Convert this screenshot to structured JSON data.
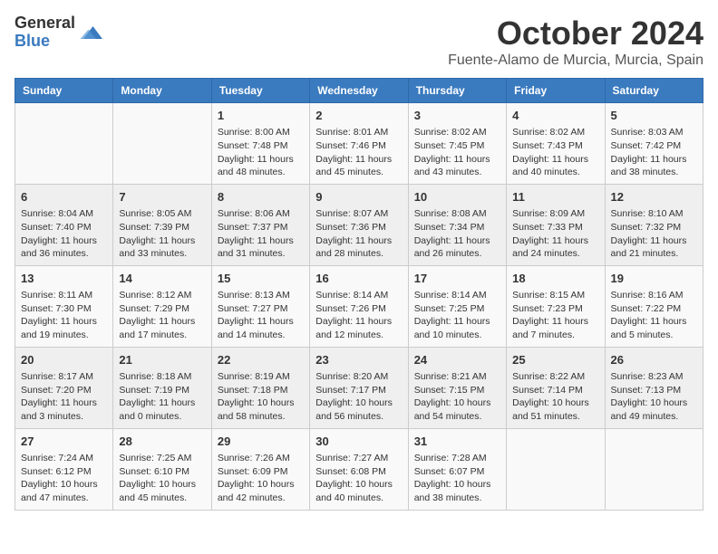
{
  "header": {
    "logo_general": "General",
    "logo_blue": "Blue",
    "month": "October 2024",
    "location": "Fuente-Alamo de Murcia, Murcia, Spain"
  },
  "weekdays": [
    "Sunday",
    "Monday",
    "Tuesday",
    "Wednesday",
    "Thursday",
    "Friday",
    "Saturday"
  ],
  "weeks": [
    [
      {
        "day": "",
        "info": ""
      },
      {
        "day": "",
        "info": ""
      },
      {
        "day": "1",
        "info": "Sunrise: 8:00 AM\nSunset: 7:48 PM\nDaylight: 11 hours and 48 minutes."
      },
      {
        "day": "2",
        "info": "Sunrise: 8:01 AM\nSunset: 7:46 PM\nDaylight: 11 hours and 45 minutes."
      },
      {
        "day": "3",
        "info": "Sunrise: 8:02 AM\nSunset: 7:45 PM\nDaylight: 11 hours and 43 minutes."
      },
      {
        "day": "4",
        "info": "Sunrise: 8:02 AM\nSunset: 7:43 PM\nDaylight: 11 hours and 40 minutes."
      },
      {
        "day": "5",
        "info": "Sunrise: 8:03 AM\nSunset: 7:42 PM\nDaylight: 11 hours and 38 minutes."
      }
    ],
    [
      {
        "day": "6",
        "info": "Sunrise: 8:04 AM\nSunset: 7:40 PM\nDaylight: 11 hours and 36 minutes."
      },
      {
        "day": "7",
        "info": "Sunrise: 8:05 AM\nSunset: 7:39 PM\nDaylight: 11 hours and 33 minutes."
      },
      {
        "day": "8",
        "info": "Sunrise: 8:06 AM\nSunset: 7:37 PM\nDaylight: 11 hours and 31 minutes."
      },
      {
        "day": "9",
        "info": "Sunrise: 8:07 AM\nSunset: 7:36 PM\nDaylight: 11 hours and 28 minutes."
      },
      {
        "day": "10",
        "info": "Sunrise: 8:08 AM\nSunset: 7:34 PM\nDaylight: 11 hours and 26 minutes."
      },
      {
        "day": "11",
        "info": "Sunrise: 8:09 AM\nSunset: 7:33 PM\nDaylight: 11 hours and 24 minutes."
      },
      {
        "day": "12",
        "info": "Sunrise: 8:10 AM\nSunset: 7:32 PM\nDaylight: 11 hours and 21 minutes."
      }
    ],
    [
      {
        "day": "13",
        "info": "Sunrise: 8:11 AM\nSunset: 7:30 PM\nDaylight: 11 hours and 19 minutes."
      },
      {
        "day": "14",
        "info": "Sunrise: 8:12 AM\nSunset: 7:29 PM\nDaylight: 11 hours and 17 minutes."
      },
      {
        "day": "15",
        "info": "Sunrise: 8:13 AM\nSunset: 7:27 PM\nDaylight: 11 hours and 14 minutes."
      },
      {
        "day": "16",
        "info": "Sunrise: 8:14 AM\nSunset: 7:26 PM\nDaylight: 11 hours and 12 minutes."
      },
      {
        "day": "17",
        "info": "Sunrise: 8:14 AM\nSunset: 7:25 PM\nDaylight: 11 hours and 10 minutes."
      },
      {
        "day": "18",
        "info": "Sunrise: 8:15 AM\nSunset: 7:23 PM\nDaylight: 11 hours and 7 minutes."
      },
      {
        "day": "19",
        "info": "Sunrise: 8:16 AM\nSunset: 7:22 PM\nDaylight: 11 hours and 5 minutes."
      }
    ],
    [
      {
        "day": "20",
        "info": "Sunrise: 8:17 AM\nSunset: 7:20 PM\nDaylight: 11 hours and 3 minutes."
      },
      {
        "day": "21",
        "info": "Sunrise: 8:18 AM\nSunset: 7:19 PM\nDaylight: 11 hours and 0 minutes."
      },
      {
        "day": "22",
        "info": "Sunrise: 8:19 AM\nSunset: 7:18 PM\nDaylight: 10 hours and 58 minutes."
      },
      {
        "day": "23",
        "info": "Sunrise: 8:20 AM\nSunset: 7:17 PM\nDaylight: 10 hours and 56 minutes."
      },
      {
        "day": "24",
        "info": "Sunrise: 8:21 AM\nSunset: 7:15 PM\nDaylight: 10 hours and 54 minutes."
      },
      {
        "day": "25",
        "info": "Sunrise: 8:22 AM\nSunset: 7:14 PM\nDaylight: 10 hours and 51 minutes."
      },
      {
        "day": "26",
        "info": "Sunrise: 8:23 AM\nSunset: 7:13 PM\nDaylight: 10 hours and 49 minutes."
      }
    ],
    [
      {
        "day": "27",
        "info": "Sunrise: 7:24 AM\nSunset: 6:12 PM\nDaylight: 10 hours and 47 minutes."
      },
      {
        "day": "28",
        "info": "Sunrise: 7:25 AM\nSunset: 6:10 PM\nDaylight: 10 hours and 45 minutes."
      },
      {
        "day": "29",
        "info": "Sunrise: 7:26 AM\nSunset: 6:09 PM\nDaylight: 10 hours and 42 minutes."
      },
      {
        "day": "30",
        "info": "Sunrise: 7:27 AM\nSunset: 6:08 PM\nDaylight: 10 hours and 40 minutes."
      },
      {
        "day": "31",
        "info": "Sunrise: 7:28 AM\nSunset: 6:07 PM\nDaylight: 10 hours and 38 minutes."
      },
      {
        "day": "",
        "info": ""
      },
      {
        "day": "",
        "info": ""
      }
    ]
  ]
}
